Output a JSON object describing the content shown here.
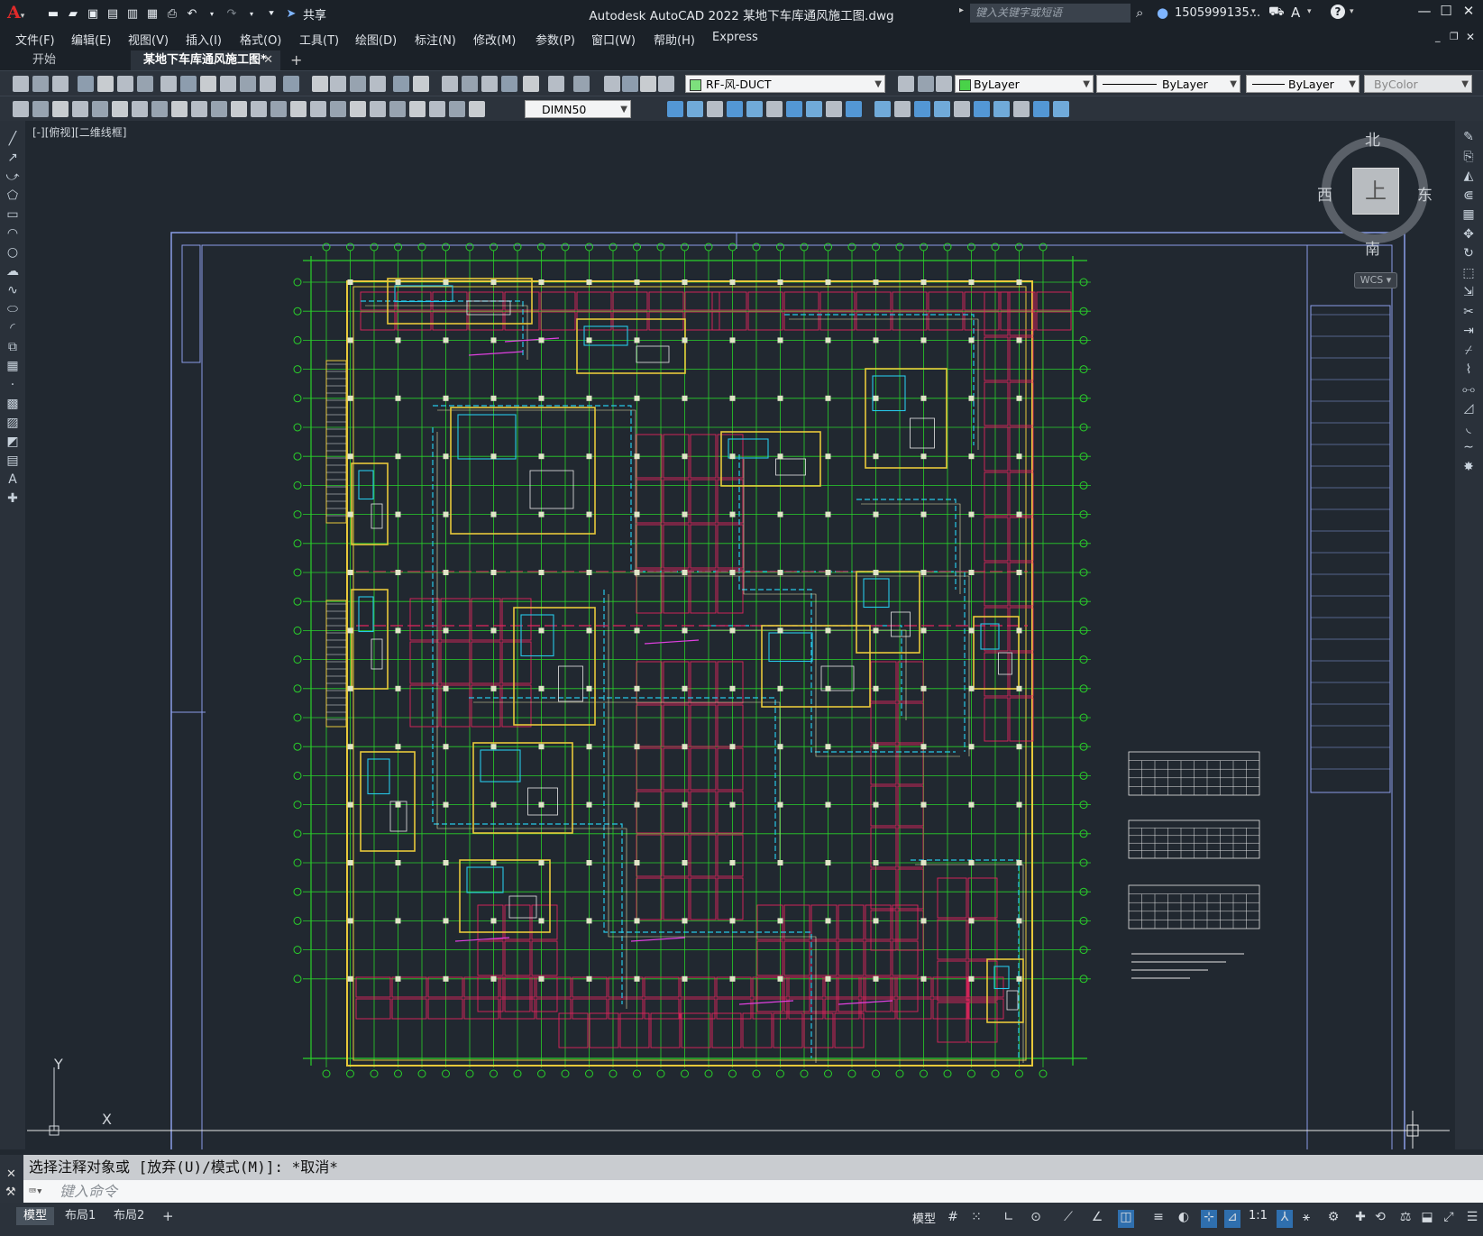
{
  "app": {
    "title": "Autodesk AutoCAD 2022    某地下车库通风施工图.dwg",
    "share_label": "共享",
    "search_placeholder": "键入关键字或短语",
    "user": "1505999135...",
    "menus": [
      "文件(F)",
      "编辑(E)",
      "视图(V)",
      "插入(I)",
      "格式(O)",
      "工具(T)",
      "绘图(D)",
      "标注(N)",
      "修改(M)",
      "参数(P)",
      "窗口(W)",
      "帮助(H)",
      "Express"
    ],
    "tabs": [
      {
        "label": "开始",
        "active": false
      },
      {
        "label": "某地下车库通风施工图*",
        "active": true
      }
    ]
  },
  "properties": {
    "layer": "RF-风-DUCT",
    "color": "ByLayer",
    "linetype": "ByLayer",
    "lineweight": "ByLayer",
    "plotstyle": "ByColor",
    "dimstyle": "DIMN50",
    "layer_color": "#7de07d"
  },
  "viewport": {
    "label": "[-][俯视][二维线框]",
    "viewcube": {
      "north": "北",
      "south": "南",
      "east": "东",
      "west": "西",
      "top": "上",
      "wcs": "WCS"
    },
    "ucs": {
      "x": "X",
      "y": "Y"
    }
  },
  "command": {
    "history": "选择注释对象或 [放弃(U)/模式(M)]: *取消*",
    "prompt": "键入命令"
  },
  "layouts": [
    "模型",
    "布局1",
    "布局2"
  ],
  "status": {
    "model_label": "模型",
    "scale": "1:1"
  },
  "colors": {
    "canvas": "#212830",
    "frame": "#8a9de8",
    "axis": "#29d12a",
    "wall": "#e8c93a",
    "duct": "#e0245d",
    "pipe": "#27c7e8",
    "magenta": "#e040e0"
  }
}
